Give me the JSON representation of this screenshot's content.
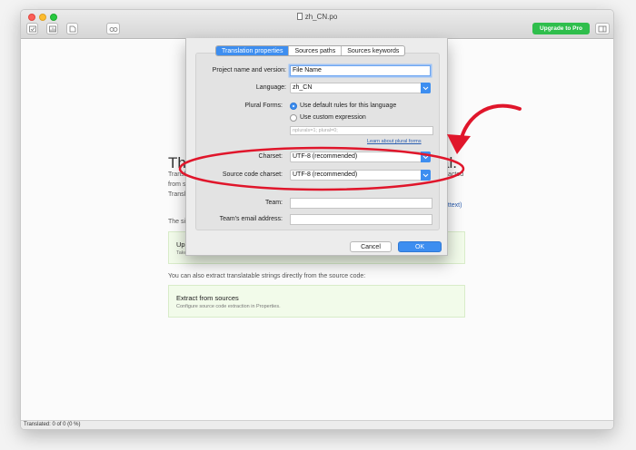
{
  "window": {
    "title": "zh_CN.po",
    "upgrade_label": "Upgrade to Pro",
    "status": "Translated: 0 of 0 (0 %)"
  },
  "background": {
    "heading_left": "Th",
    "heading_right": "al.",
    "lines": [
      "Transl",
      "from s",
      "Transl",
      "The si"
    ],
    "extract_fragment": "acted",
    "gettext_link": "ettext)",
    "update_box": {
      "title": "Upd",
      "subtitle": "Take"
    },
    "source_intro": "You can also extract translatable strings directly from the source code:",
    "extract_box": {
      "title": "Extract from sources",
      "subtitle": "Configure source code extraction in Properties."
    }
  },
  "dialog": {
    "tabs": [
      {
        "label": "Translation properties",
        "active": true
      },
      {
        "label": "Sources paths",
        "active": false
      },
      {
        "label": "Sources keywords",
        "active": false
      }
    ],
    "project_label": "Project name and version:",
    "project_value": "File Name",
    "language_label": "Language:",
    "language_value": "zh_CN",
    "plural_label": "Plural Forms:",
    "plural_default": "Use default rules for this language",
    "plural_custom": "Use custom expression",
    "plural_placeholder": "nplurals=1; plural=0;",
    "plural_link": "Learn about plural forms",
    "charset_label": "Charset:",
    "charset_value": "UTF-8 (recommended)",
    "source_charset_label": "Source code charset:",
    "source_charset_value": "UTF-8 (recommended)",
    "team_label": "Team:",
    "team_email_label": "Team's email address:",
    "cancel_label": "Cancel",
    "ok_label": "OK"
  },
  "colors": {
    "accent": "#3d8ef0",
    "upgrade": "#2fbe4c",
    "annotation": "#e0162b"
  }
}
